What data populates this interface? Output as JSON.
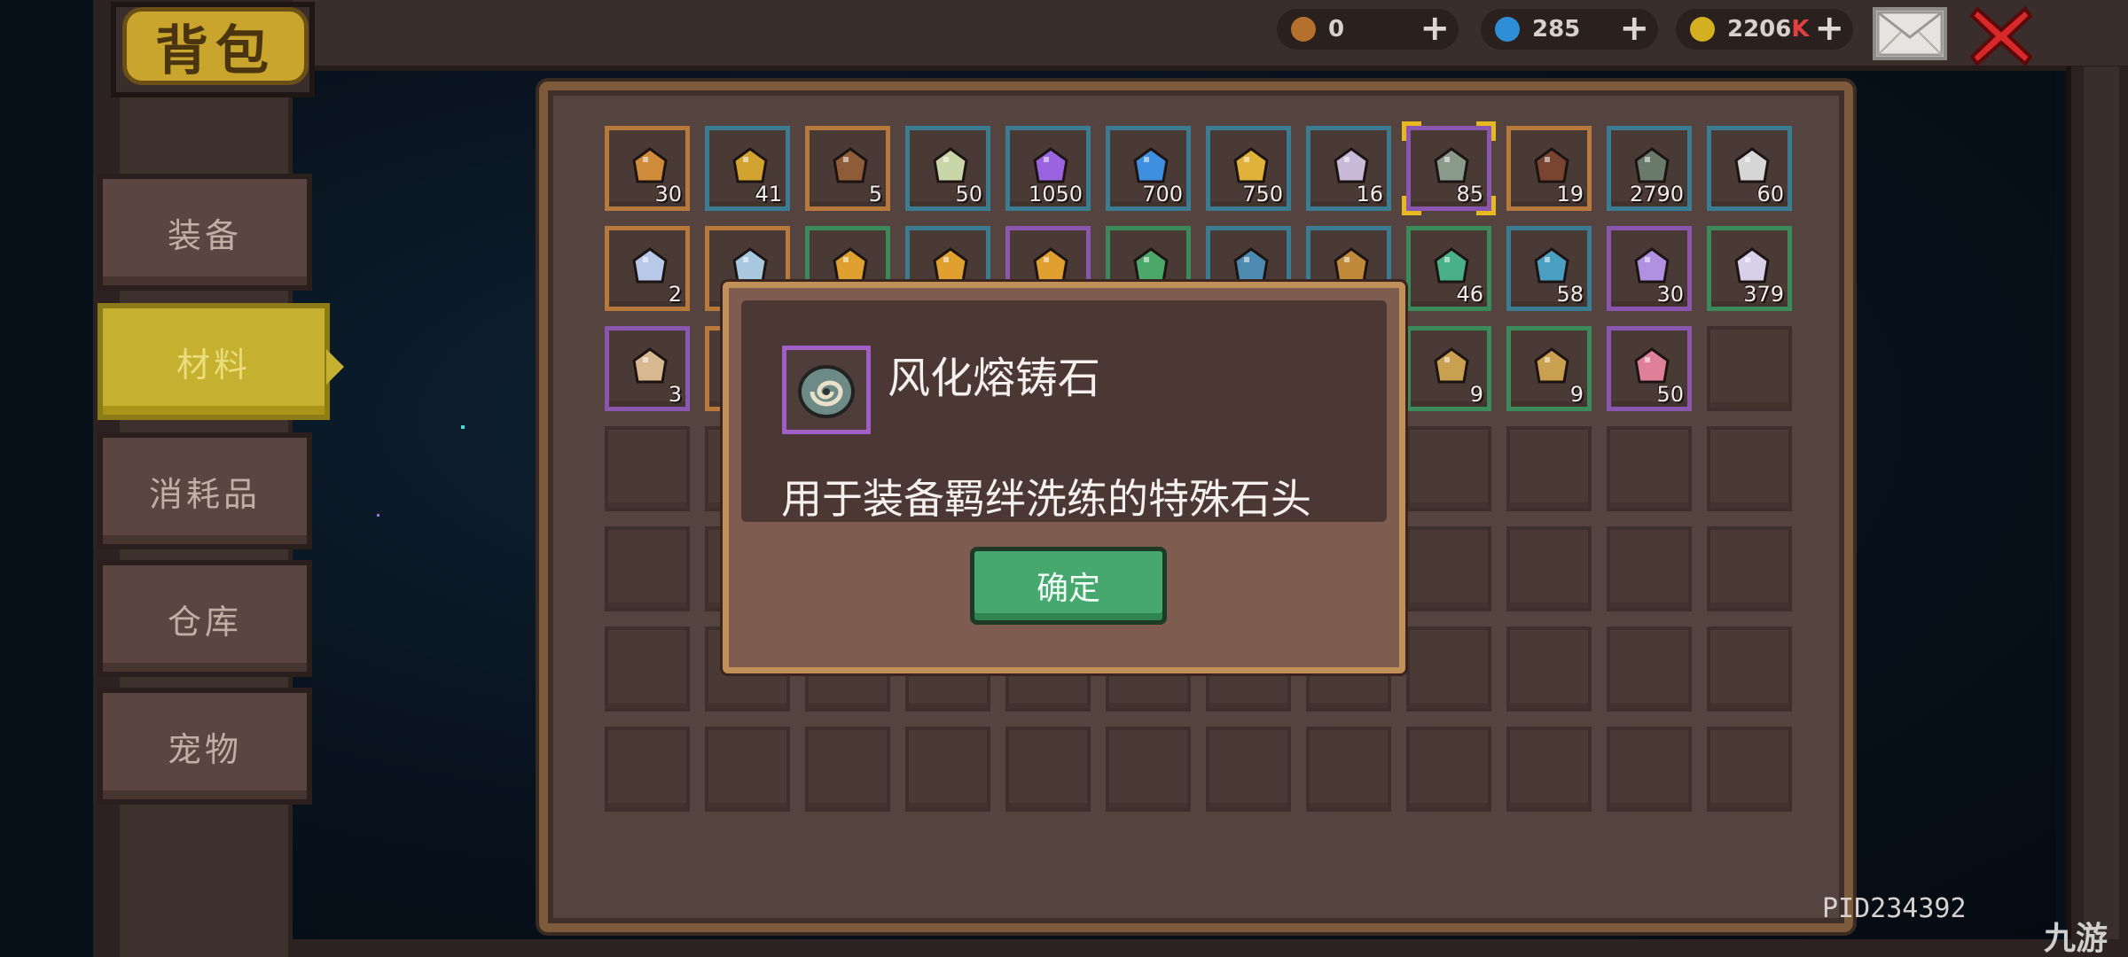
{
  "header": {
    "title": "背包"
  },
  "currencies": [
    {
      "name": "key-currency",
      "value": "0",
      "color": "#b5702e"
    },
    {
      "name": "gem-currency",
      "value": "285",
      "color": "#2e8fd6"
    },
    {
      "name": "gold-currency",
      "value": "2206",
      "unit": "K",
      "color": "#d4b020"
    }
  ],
  "tabs": [
    {
      "label": "装备",
      "active": false
    },
    {
      "label": "材料",
      "active": true
    },
    {
      "label": "消耗品",
      "active": false
    },
    {
      "label": "仓库",
      "active": false
    },
    {
      "label": "宠物",
      "active": false
    }
  ],
  "inventory": {
    "rows": [
      [
        {
          "icon": "bronze-key-icon",
          "count": "30",
          "frame": "#b77a3c",
          "color": "#d08b3a"
        },
        {
          "icon": "gold-coin-token-icon",
          "count": "41",
          "frame": "#3c7c92",
          "color": "#d3a331"
        },
        {
          "icon": "scroll-tube-icon",
          "count": "5",
          "frame": "#b77a3c",
          "color": "#8f5c3a"
        },
        {
          "icon": "rainbow-orb-icon",
          "count": "50",
          "frame": "#3c7c92",
          "color": "#c9d6a8"
        },
        {
          "icon": "purple-crystal-icon",
          "count": "1050",
          "frame": "#3c7c92",
          "color": "#9a64e0"
        },
        {
          "icon": "blue-crystal-icon",
          "count": "700",
          "frame": "#3c7c92",
          "color": "#3f8fe0"
        },
        {
          "icon": "gold-crystal-icon",
          "count": "750",
          "frame": "#3c7c92",
          "color": "#e0b23a"
        },
        {
          "icon": "chain-link-icon",
          "count": "16",
          "frame": "#3c7c92",
          "color": "#c9b9d8"
        },
        {
          "icon": "weathered-stone-icon",
          "count": "85",
          "frame": "#8a56b0",
          "color": "#8a9a8a",
          "selected": true
        },
        {
          "icon": "spiral-stone-icon",
          "count": "19",
          "frame": "#b77a3c",
          "color": "#7a4530"
        },
        {
          "icon": "ticket-icon",
          "count": "2790",
          "frame": "#3c7c92",
          "color": "#6a7a6a"
        },
        {
          "icon": "feather-icon",
          "count": "60",
          "frame": "#3c7c92",
          "color": "#d6d6d6"
        }
      ],
      [
        {
          "icon": "rainbow-gem-icon",
          "count": "2",
          "frame": "#b77a3c",
          "color": "#b8c8e8"
        },
        {
          "icon": "prism-gem-icon",
          "count": "",
          "frame": "#b77a3c",
          "color": "#a8c8e0"
        },
        {
          "icon": "gold-crown-icon",
          "count": "",
          "frame": "#3a8a5a",
          "color": "#e0a030"
        },
        {
          "icon": "gold-crown-icon",
          "count": "",
          "frame": "#3c7c92",
          "color": "#e0a030"
        },
        {
          "icon": "gold-crown-icon",
          "count": "",
          "frame": "#8a56b0",
          "color": "#e0a030"
        },
        {
          "icon": "green-leaf-icon",
          "count": "",
          "frame": "#3a8a5a",
          "color": "#4ca86a"
        },
        {
          "icon": "blue-leaf-icon",
          "count": "",
          "frame": "#3c7c92",
          "color": "#4c8ab0"
        },
        {
          "icon": "torch-icon",
          "count": "",
          "frame": "#3c7c92",
          "color": "#c08a3a"
        },
        {
          "icon": "green-rune-icon",
          "count": "46",
          "frame": "#3a8a5a",
          "color": "#4ab08a"
        },
        {
          "icon": "blue-rune-icon",
          "count": "58",
          "frame": "#3c7c92",
          "color": "#4aa0c0"
        },
        {
          "icon": "purple-key-icon",
          "count": "30",
          "frame": "#8a56b0",
          "color": "#b090e0"
        },
        {
          "icon": "skull-icon",
          "count": "379",
          "frame": "#3a8a5a",
          "color": "#d8d0e8"
        }
      ],
      [
        {
          "icon": "bone-chain-icon",
          "count": "3",
          "frame": "#8a56b0",
          "color": "#d8b890"
        },
        {
          "icon": "red-item-icon",
          "count": "",
          "frame": "#b77a3c",
          "color": "#c04040"
        },
        {
          "icon": "",
          "count": "",
          "frame": "",
          "color": ""
        },
        {
          "icon": "",
          "count": "",
          "frame": "",
          "color": ""
        },
        {
          "icon": "",
          "count": "",
          "frame": "",
          "color": ""
        },
        {
          "icon": "",
          "count": "",
          "frame": "",
          "color": ""
        },
        {
          "icon": "",
          "count": "",
          "frame": "",
          "color": ""
        },
        {
          "icon": "",
          "count": "",
          "frame": "",
          "color": ""
        },
        {
          "icon": "map-scroll-icon",
          "count": "9",
          "frame": "#3a8a5a",
          "color": "#c8a050"
        },
        {
          "icon": "map-scroll-icon",
          "count": "9",
          "frame": "#3a8a5a",
          "color": "#c8a050"
        },
        {
          "icon": "pink-crystal-icon",
          "count": "50",
          "frame": "#8a56b0",
          "color": "#e08098"
        },
        {
          "icon": "",
          "count": "",
          "frame": "",
          "color": ""
        }
      ]
    ],
    "empty_rows": 4
  },
  "dialog": {
    "item_name": "风化熔铸石",
    "description": "用于装备羁绊洗练的特殊石头",
    "confirm_label": "确定",
    "icon": "weathered-stone-icon"
  },
  "footer": {
    "pid": "PID234392"
  },
  "watermark": "九游"
}
